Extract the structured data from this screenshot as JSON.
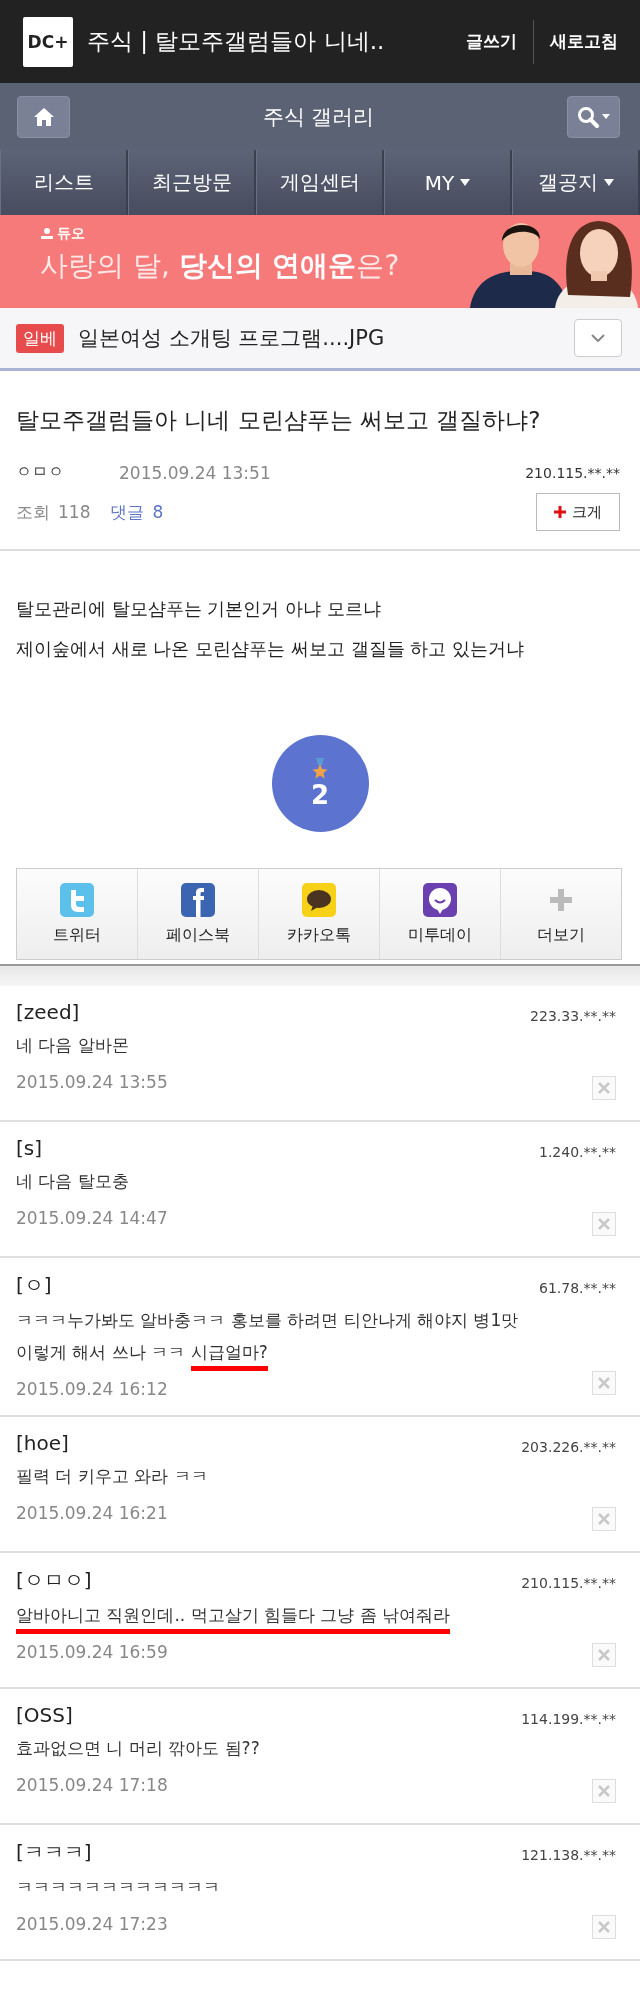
{
  "header": {
    "logo": "DC+",
    "title": "주식 | 탈모주갤럼들아 니네..",
    "buttons": [
      "글쓰기",
      "새로고침"
    ]
  },
  "gallery_bar": {
    "title": "주식 갤러리"
  },
  "nav": [
    {
      "label": "리스트",
      "dropdown": false
    },
    {
      "label": "최근방문",
      "dropdown": false
    },
    {
      "label": "게임센터",
      "dropdown": false
    },
    {
      "label": "MY",
      "dropdown": true
    },
    {
      "label": "갤공지",
      "dropdown": true
    }
  ],
  "ad_banner": {
    "brand": "듀오",
    "headline": "사랑의 달, **당신의 연애운**은?"
  },
  "hot_post": {
    "tag": "일베",
    "title": "일본여성 소개팅 프로그램....JPG"
  },
  "post": {
    "title": "탈모주갤럼들아  니네 모린샴푸는 써보고 갤질하냐?",
    "author": "ㅇㅁㅇ",
    "date": "2015.09.24 13:51",
    "ip": "210.115.**.**",
    "views_label": "조회",
    "views": "118",
    "comments_label": "댓글",
    "comments": "8",
    "zoom_button": "크게",
    "body": [
      "탈모관리에 탈모샴푸는 기본인거 아냐 모르냐",
      "제이숲에서 새로 나온 모린샴푸는 써보고 갤질들 하고 있는거냐"
    ],
    "recommend_count": "2"
  },
  "share": [
    {
      "kind": "twitter",
      "label": "트위터"
    },
    {
      "kind": "facebook",
      "label": "페이스북"
    },
    {
      "kind": "kakaotalk",
      "label": "카카오톡"
    },
    {
      "kind": "me2day",
      "label": "미투데이"
    },
    {
      "kind": "more",
      "label": "더보기"
    }
  ],
  "comments": [
    {
      "name": "[zeed]",
      "ip": "223.33.**.**",
      "lines": [
        [
          {
            "text": "네 다음 알바몬",
            "underlined": false
          }
        ]
      ],
      "date": "2015.09.24 13:55"
    },
    {
      "name": "[s]",
      "ip": "1.240.**.**",
      "lines": [
        [
          {
            "text": "네 다음 탈모충",
            "underlined": false
          }
        ]
      ],
      "date": "2015.09.24 14:47"
    },
    {
      "name": "[ㅇ]",
      "ip": "61.78.**.**",
      "lines": [
        [
          {
            "text": "ㅋㅋㅋ누가봐도 알바충ㅋㅋ 홍보를 하려면 티안나게 해야지 병1맛",
            "underlined": false
          }
        ],
        [
          {
            "text": "이렇게 해서 쓰나 ㅋㅋ ",
            "underlined": false
          },
          {
            "text": "시급얼마?",
            "underlined": true
          }
        ]
      ],
      "date": "2015.09.24 16:12"
    },
    {
      "name": "[hoe]",
      "ip": "203.226.**.**",
      "lines": [
        [
          {
            "text": "필력 더 키우고 와라 ㅋㅋ",
            "underlined": false
          }
        ]
      ],
      "date": "2015.09.24 16:21"
    },
    {
      "name": "[ㅇㅁㅇ]",
      "ip": "210.115.**.**",
      "lines": [
        [
          {
            "text": "알바아니고 직원인데.. 먹고살기 힘들다 그냥 좀 낚여줘라",
            "underlined": true
          }
        ]
      ],
      "date": "2015.09.24 16:59"
    },
    {
      "name": "[OSS]",
      "ip": "114.199.**.**",
      "lines": [
        [
          {
            "text": "효과없으면 니 머리 깎아도 됨??",
            "underlined": false
          }
        ]
      ],
      "date": "2015.09.24 17:18"
    },
    {
      "name": "[ㅋㅋㅋ]",
      "ip": "121.138.**.**",
      "lines": [
        [
          {
            "text": "ㅋㅋㅋㅋㅋㅋㅋㅋㅋㅋㅋㅋ",
            "underlined": false
          }
        ]
      ],
      "date": "2015.09.24 17:23"
    }
  ]
}
